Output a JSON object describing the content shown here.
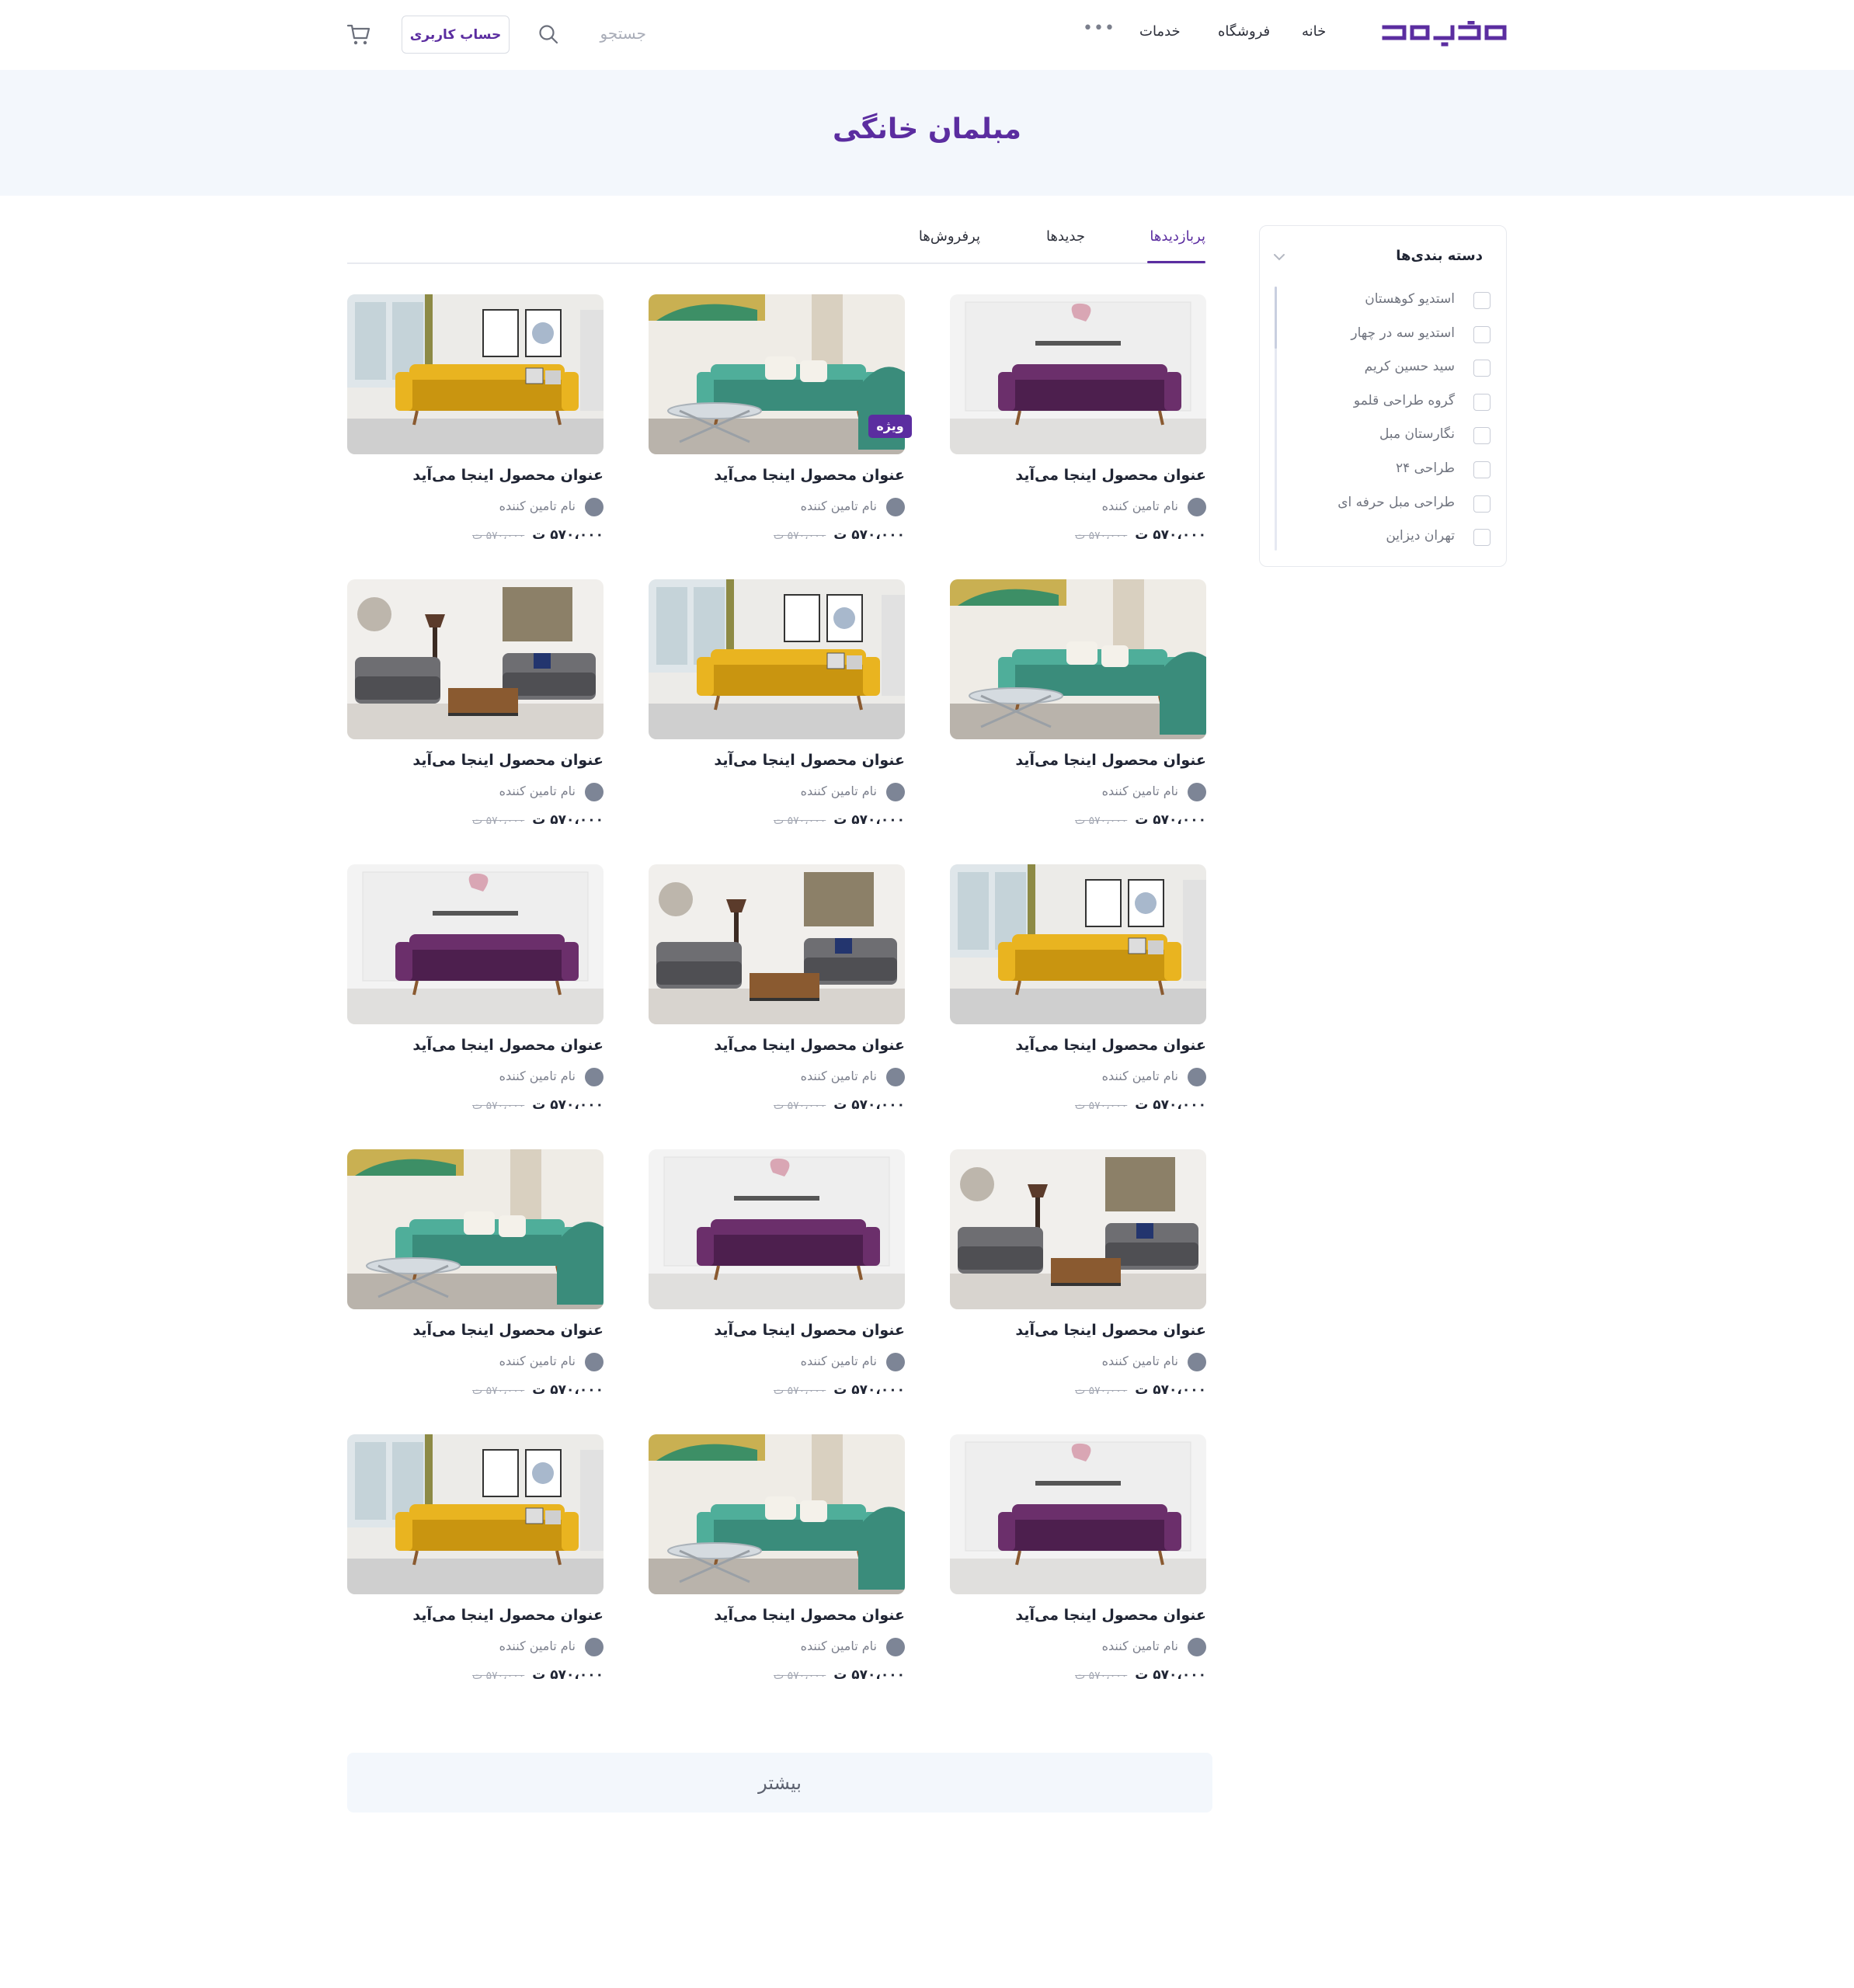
{
  "header": {
    "logo_label": "logo",
    "nav": [
      "خانه",
      "فروشگاه",
      "خدمات"
    ],
    "more_label": "•••",
    "search_placeholder": "جستجو",
    "account_label": "حساب کاربری"
  },
  "banner": {
    "title": "مبلمان خانگی"
  },
  "sidebar": {
    "title": "دسته بندی‌ها",
    "categories": [
      "استدیو کوهستان",
      "استدیو سه در چهار",
      "سید حسین کریم",
      "گروه طراحی قلمو",
      "نگارستان مبل",
      "طراحی ۲۴",
      "طراحی مبل حرفه ای",
      "تهران دیزاین"
    ]
  },
  "tabs": [
    "پربازدیدها",
    "جدیدها",
    "پرفروش‌ها"
  ],
  "product_defaults": {
    "title": "عنوان محصول اینجا می‌آید",
    "supplier": "نام تامین کننده",
    "price": "۵۷۰،۰۰۰ ت",
    "old_price": "۵۷۰،۰۰۰ ت"
  },
  "badge_label": "ویژه",
  "products": [
    {
      "image": "purple-sofa",
      "badge": false
    },
    {
      "image": "teal-sofa",
      "badge": true
    },
    {
      "image": "yellow-sofa",
      "badge": false
    },
    {
      "image": "teal-sofa",
      "badge": false
    },
    {
      "image": "yellow-sofa",
      "badge": false
    },
    {
      "image": "gray-sofa",
      "badge": false
    },
    {
      "image": "yellow-sofa",
      "badge": false
    },
    {
      "image": "gray-sofa",
      "badge": false
    },
    {
      "image": "purple-sofa",
      "badge": false
    },
    {
      "image": "gray-sofa",
      "badge": false
    },
    {
      "image": "purple-sofa",
      "badge": false
    },
    {
      "image": "teal-sofa",
      "badge": false
    },
    {
      "image": "purple-sofa",
      "badge": false
    },
    {
      "image": "teal-sofa",
      "badge": false
    },
    {
      "image": "yellow-sofa",
      "badge": false
    }
  ],
  "more_label": "بیشتر",
  "colors": {
    "accent": "#5b2da0",
    "banner_bg": "#f3f7fc",
    "purple_sofa": "#6b2f6b",
    "teal_sofa": "#4fae9a",
    "yellow_sofa": "#e9b420",
    "gray_sofa": "#6e6e72"
  }
}
